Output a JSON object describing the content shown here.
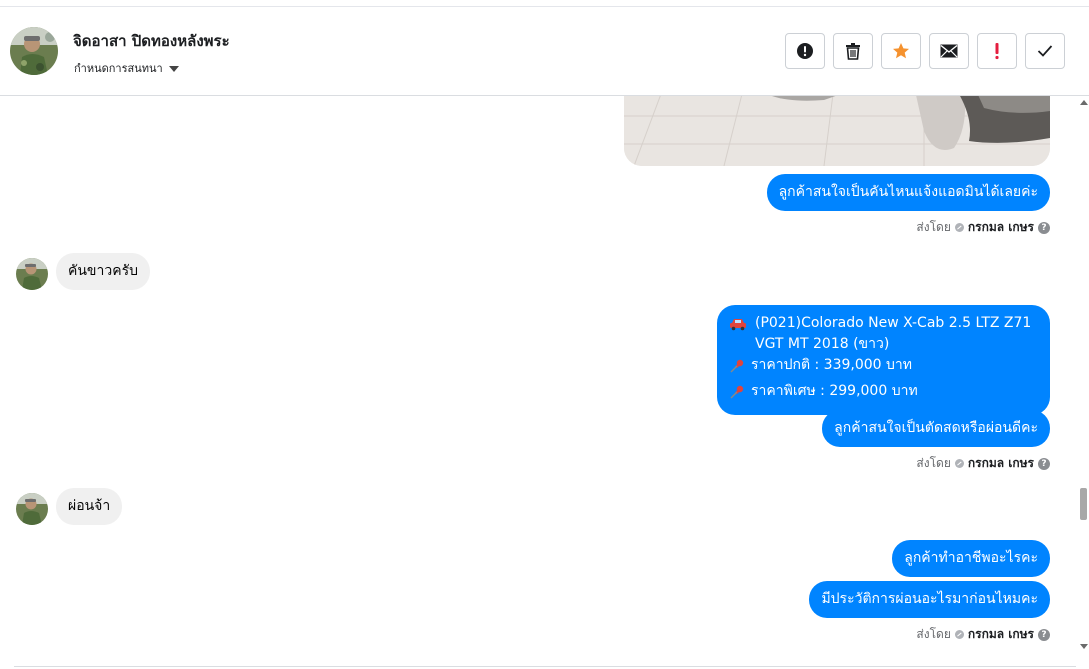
{
  "header": {
    "user_name": "จิดอาสา ปิดทองหลังพระ",
    "conversation_label": "กำหนดการสนทนา"
  },
  "actions": [
    {
      "name": "report-button",
      "icon": "exclamation-circle-icon"
    },
    {
      "name": "delete-button",
      "icon": "trash-icon"
    },
    {
      "name": "star-button",
      "icon": "star-icon",
      "color": "#f5922f"
    },
    {
      "name": "mail-button",
      "icon": "envelope-icon"
    },
    {
      "name": "important-button",
      "icon": "exclamation-icon",
      "color": "#e41e3f"
    },
    {
      "name": "done-button",
      "icon": "check-icon"
    }
  ],
  "messages": {
    "m1": "ลูกค้าสนใจเป็นคันไหนแจ้งแอดมินได้เลยค่ะ",
    "r1": "คันขาวครับ",
    "card": {
      "title_line1": "(P021)Colorado New X-Cab 2.5 LTZ Z71",
      "title_line2": "VGT MT 2018 (ขาว)",
      "price_normal": "ราคาปกติ : 339,000 บาท",
      "price_special": "ราคาพิเศษ : 299,000 บาท"
    },
    "m2": "ลูกค้าสนใจเป็นตัดสดหรือผ่อนดีคะ",
    "r2": "ผ่อนจ้า",
    "m3": "ลูกค้าทำอาชีพอะไรคะ",
    "m4": "มีประวัติการผ่อนอะไรมาก่อนไหมคะ"
  },
  "sent_by": {
    "prefix": "ส่งโดย",
    "sender": "กรกมล เกษร",
    "help": "?"
  },
  "colors": {
    "outgoing_bubble": "#0084ff",
    "incoming_bubble": "#f0f0f0"
  }
}
